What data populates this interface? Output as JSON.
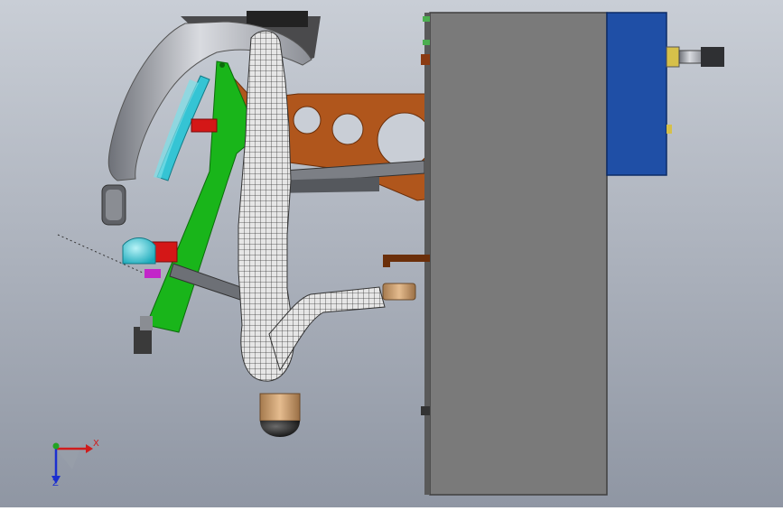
{
  "viewport": {
    "background_top": "#c9ced6",
    "background_bottom": "#8f96a3"
  },
  "triad": {
    "x_label": "X",
    "z_label": "Z",
    "x_color": "#d01c1c",
    "y_color": "#22a322",
    "z_color": "#1c2fd0"
  },
  "colors": {
    "panel": "#7a7a7a",
    "panel_edge": "#3f3f3f",
    "blue_box": "#1f4fa6",
    "green_arm": "#19b51a",
    "copper_plate": "#b0561c",
    "cyan": "#35c4d4",
    "red_pin": "#d41717",
    "silver": "#b9bcc2",
    "mesh_body": "#e2e2e2",
    "mesh_line": "#3a3a3a",
    "tan_tip": "#c89a6a",
    "dark": "#2a2a2a"
  }
}
